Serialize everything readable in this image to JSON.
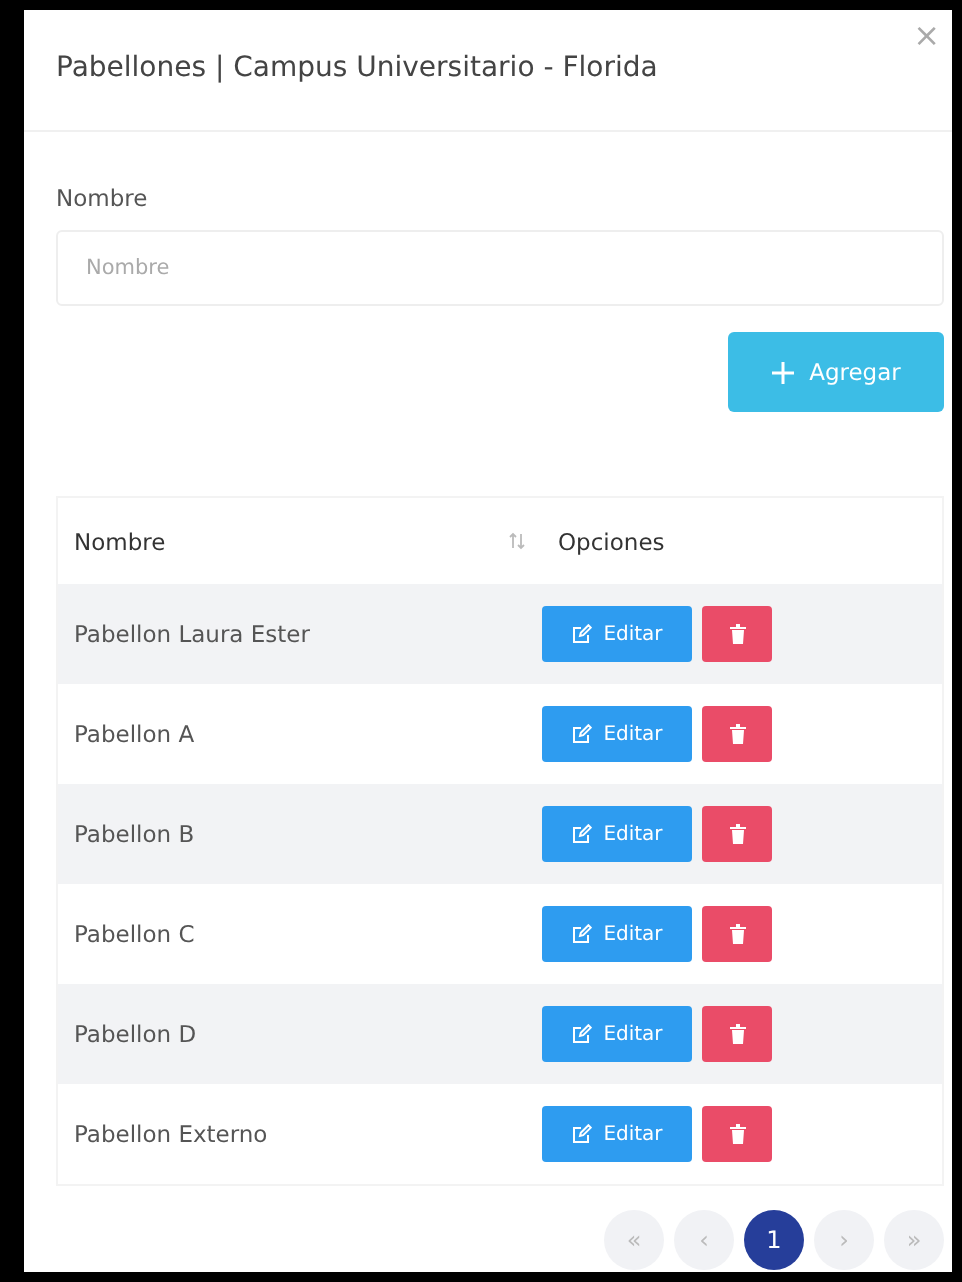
{
  "modal": {
    "title": "Pabellones | Campus Universitario - Florida",
    "close": "×"
  },
  "form": {
    "label": "Nombre",
    "placeholder": "Nombre",
    "submit": "Agregar"
  },
  "table": {
    "columns": [
      {
        "label": "Nombre",
        "sortable": true
      },
      {
        "label": "Opciones",
        "sortable": false
      }
    ],
    "rows": [
      {
        "name": "Pabellon Laura Ester",
        "edit": "Editar"
      },
      {
        "name": "Pabellon A",
        "edit": "Editar"
      },
      {
        "name": "Pabellon B",
        "edit": "Editar"
      },
      {
        "name": "Pabellon C",
        "edit": "Editar"
      },
      {
        "name": "Pabellon D",
        "edit": "Editar"
      },
      {
        "name": "Pabellon Externo",
        "edit": "Editar"
      }
    ]
  },
  "pagination": [
    {
      "label": "«",
      "selected": false
    },
    {
      "label": "‹",
      "selected": false
    },
    {
      "label": "1",
      "selected": true
    },
    {
      "label": "›",
      "selected": false
    },
    {
      "label": "»",
      "selected": false
    }
  ]
}
